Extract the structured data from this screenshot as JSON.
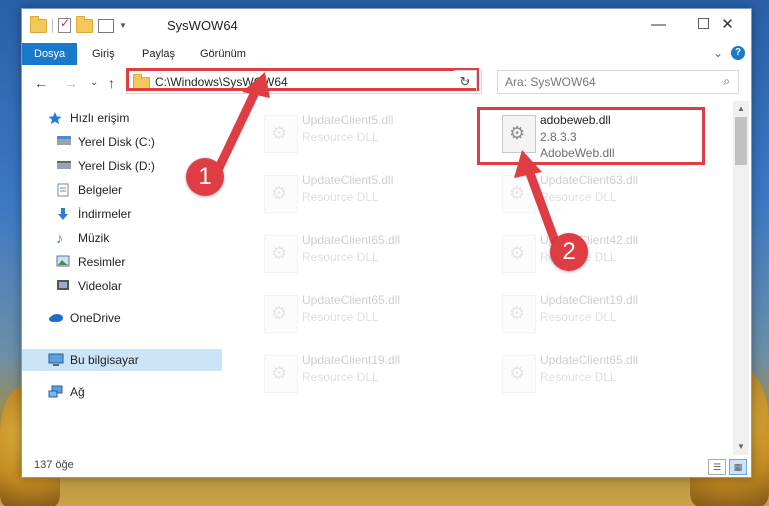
{
  "titlebar": {
    "title": "SysWOW64",
    "minimize": "—",
    "maximize": "☐",
    "close": "✕"
  },
  "ribbon": {
    "tabs": [
      "Dosya",
      "Giriş",
      "Paylaş",
      "Görünüm"
    ],
    "active_tab": "Dosya",
    "collapse": "⌄",
    "help": "?"
  },
  "navigation": {
    "back": "←",
    "forward": "→",
    "recent": "⌄",
    "up": "↑",
    "address": "C:\\Windows\\SysWOW64",
    "dropdown": "⌄",
    "refresh": "↻",
    "search_placeholder": "Ara: SysWOW64",
    "search_icon": "⌕"
  },
  "sidebar": {
    "items": [
      {
        "label": "Hızlı erişim",
        "icon": "star-icon"
      },
      {
        "label": "Yerel Disk (C:)",
        "icon": "drive-icon",
        "pinned": true
      },
      {
        "label": "Yerel Disk (D:)",
        "icon": "drive-icon",
        "pinned": true
      },
      {
        "label": "Belgeler",
        "icon": "documents-icon"
      },
      {
        "label": "İndirmeler",
        "icon": "download-icon",
        "pinned": true
      },
      {
        "label": "Müzik",
        "icon": "music-icon",
        "pinned": true
      },
      {
        "label": "Resimler",
        "icon": "pictures-icon",
        "pinned": true
      },
      {
        "label": "Videolar",
        "icon": "video-icon",
        "pinned": true
      },
      {
        "label": "OneDrive",
        "icon": "cloud-icon"
      },
      {
        "label": "Bu bilgisayar",
        "icon": "computer-icon",
        "selected": true
      },
      {
        "label": "Ağ",
        "icon": "network-icon"
      }
    ],
    "pin_glyph": "📌"
  },
  "files": [
    {
      "name": "UpdateClient5.dll",
      "desc": "Resource DLL"
    },
    {
      "name": "adobeweb.dll",
      "desc": "2.8.3.3",
      "desc2": "AdobeWeb.dll",
      "highlighted": true
    },
    {
      "name": "UpdateClient5.dll",
      "desc": "Resource DLL"
    },
    {
      "name": "UpdateClient63.dll",
      "desc": "Resource DLL"
    },
    {
      "name": "UpdateClient65.dll",
      "desc": "Resource DLL"
    },
    {
      "name": "UpdateClient42.dll",
      "desc": "Resource DLL"
    },
    {
      "name": "UpdateClient65.dll",
      "desc": "Resource DLL"
    },
    {
      "name": "UpdateClient19.dll",
      "desc": "Resource DLL"
    },
    {
      "name": "UpdateClient19.dll",
      "desc": "Resource DLL"
    },
    {
      "name": "UpdateClient65.dll",
      "desc": "Resource DLL"
    }
  ],
  "status": {
    "count": "137 öğe"
  },
  "annotations": {
    "step1": "1",
    "step2": "2",
    "color": "#e03c44"
  },
  "colors": {
    "accent": "#1979ca",
    "selection": "#cce4f7",
    "highlight": "#e03c44"
  }
}
